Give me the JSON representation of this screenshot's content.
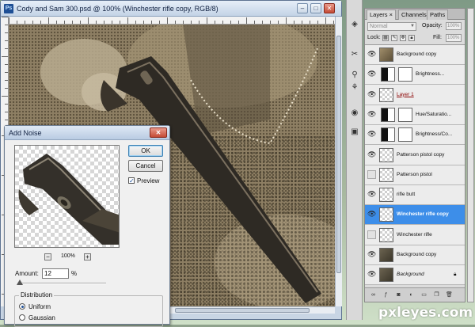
{
  "document": {
    "title": "Cody and Sam 300.psd @ 100% (Winchester rifle copy, RGB/8)",
    "app_badge": "Ps"
  },
  "dialog": {
    "title": "Add Noise",
    "ok_label": "OK",
    "cancel_label": "Cancel",
    "preview_label": "Preview",
    "preview_checked": true,
    "zoom_out": "−",
    "zoom_in": "+",
    "zoom_level": "100%",
    "amount_label": "Amount:",
    "amount_value": "12",
    "amount_unit": "%",
    "distribution_label": "Distribution",
    "distribution_options": [
      "Uniform",
      "Gaussian"
    ],
    "distribution_selected": "Uniform"
  },
  "panel": {
    "tabs": [
      "Layers ×",
      "Channels",
      "Paths"
    ],
    "active_tab": "Layers",
    "blend_mode": "Normal",
    "opacity_label": "Opacity:",
    "opacity_value": "100%",
    "lock_label": "Lock:",
    "fill_label": "Fill:",
    "fill_value": "100%",
    "layers": [
      {
        "name": "Background copy",
        "visible": true,
        "thumb": "photo"
      },
      {
        "name": "Brightness...",
        "visible": true,
        "thumb": "adj"
      },
      {
        "name": "Layer 1",
        "visible": true,
        "thumb": "transparent"
      },
      {
        "name": "Hue/Saturatio...",
        "visible": true,
        "thumb": "adj"
      },
      {
        "name": "Brightness/Co...",
        "visible": true,
        "thumb": "adj"
      },
      {
        "name": "Patterson pistol copy",
        "visible": true,
        "thumb": "transparent"
      },
      {
        "name": "Patterson pistol",
        "visible": false,
        "thumb": "transparent"
      },
      {
        "name": "rifle butt",
        "visible": true,
        "thumb": "transparent"
      },
      {
        "name": "Winchester rifle copy",
        "visible": true,
        "thumb": "transparent",
        "selected": true
      },
      {
        "name": "Winchester rifle",
        "visible": false,
        "thumb": "transparent"
      },
      {
        "name": "Background copy",
        "visible": true,
        "thumb": "photo-dark"
      },
      {
        "name": "Background",
        "visible": true,
        "thumb": "photo-dark",
        "locked": true
      }
    ]
  },
  "watermark": {
    "text": "pxleyes.com"
  },
  "colors": {
    "sepia": "#8a7b61",
    "selected_row": "#3d8ee9",
    "titlebar": "#c3d3e6"
  }
}
